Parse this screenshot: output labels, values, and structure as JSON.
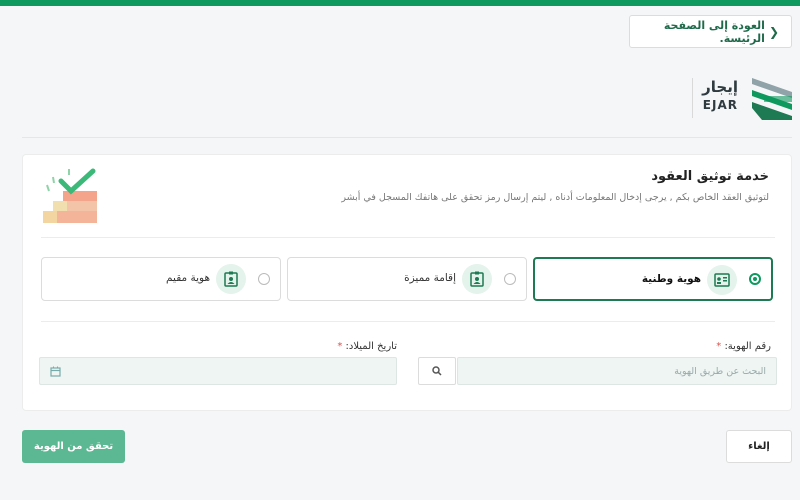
{
  "colors": {
    "brand": "#0e9a5e",
    "brand_dark": "#1d7a52",
    "primary_button": "#5bb893",
    "required": "#d9534f"
  },
  "nav": {
    "back_label": "العودة إلى الصفحة الرئيسة."
  },
  "logo": {
    "arabic": "إيجار",
    "english": "EJAR"
  },
  "service": {
    "title": "خدمة توثيق العقود",
    "subtitle": "لتوثيق العقد الخاص بكم , يرجى إدخال المعلومات أدناه , ليتم إرسال رمز تحقق على هاتفك المسجل في أبشر"
  },
  "id_types": [
    {
      "label": "هوية وطنية",
      "selected": true,
      "icon": "id-card-icon"
    },
    {
      "label": "إقامة مميزة",
      "selected": false,
      "icon": "person-badge-icon"
    },
    {
      "label": "هوية مقيم",
      "selected": false,
      "icon": "person-badge-icon"
    }
  ],
  "form": {
    "id_label": "رقم الهوية:",
    "id_placeholder": "البحث عن طريق الهوية",
    "dob_label": "تاريخ الميلاد:",
    "required_mark": "*"
  },
  "actions": {
    "verify_label": "تحقق من الهوية",
    "cancel_label": "إلغاء"
  }
}
